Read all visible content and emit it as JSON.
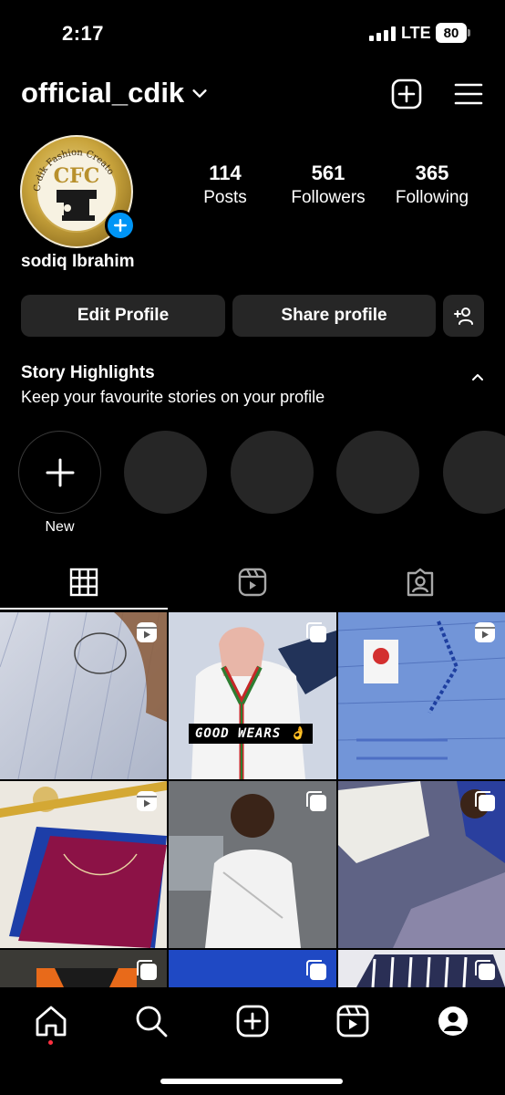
{
  "status_bar": {
    "time": "2:17",
    "network": "LTE",
    "battery": "80"
  },
  "header": {
    "username": "official_cdik"
  },
  "profile": {
    "avatar_text": {
      "arc": "C-dik Fashion Creato",
      "initials": "CFC"
    },
    "stats": [
      {
        "value": "114",
        "label": "Posts"
      },
      {
        "value": "561",
        "label": "Followers"
      },
      {
        "value": "365",
        "label": "Following"
      }
    ],
    "full_name": "sodiq Ibrahim"
  },
  "actions": {
    "edit_profile": "Edit Profile",
    "share_profile": "Share profile"
  },
  "highlights": {
    "title": "Story Highlights",
    "subtitle": "Keep your favourite stories on your profile",
    "new_label": "New"
  },
  "grid": {
    "posts": [
      {
        "type": "reel"
      },
      {
        "type": "carousel",
        "caption": "GOOD WEARS 👌"
      },
      {
        "type": "reel"
      },
      {
        "type": "reel"
      },
      {
        "type": "carousel"
      },
      {
        "type": "carousel"
      },
      {
        "type": "carousel"
      },
      {
        "type": "carousel"
      },
      {
        "type": "carousel"
      }
    ]
  },
  "nav": [
    "home-icon",
    "search-icon",
    "create-icon",
    "reels-icon",
    "profile-icon"
  ],
  "colors": {
    "background": "#000000",
    "surface": "#262626",
    "accent": "#0095f6",
    "notification": "#ff3040"
  }
}
